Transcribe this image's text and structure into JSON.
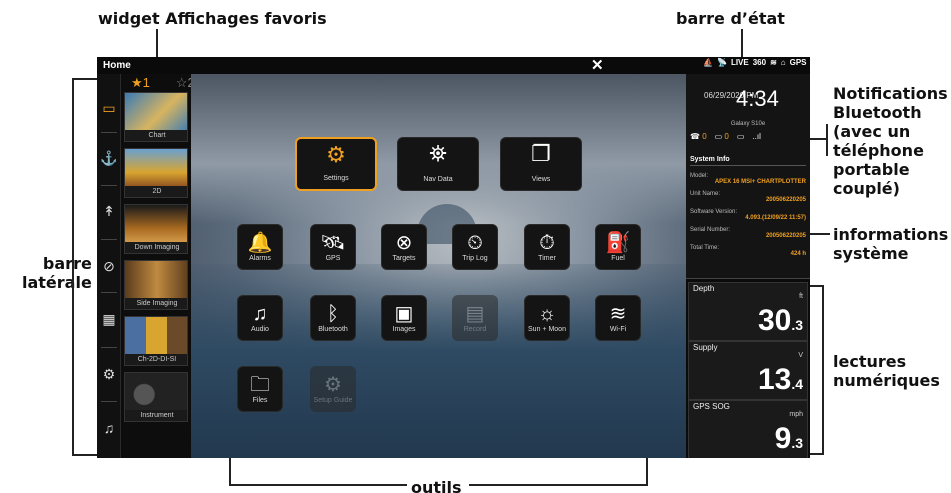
{
  "callouts": {
    "favorites_widget": "widget Affichages favoris",
    "status_bar": "barre d’état",
    "bluetooth_notifications": "Notifications\nBluetooth\n(avec un\ntéléphone\nportable\ncouplé)",
    "system_info": "informations\nsystème",
    "sidebar": "barre\nlatérale",
    "digital_readouts": "lectures\nnumériques",
    "tools": "outils"
  },
  "topbar": {
    "home": "Home",
    "close": "✕",
    "status_icons": [
      "⛵",
      "📡",
      "LIVE",
      "360",
      "≋",
      "⌂",
      "GPS"
    ]
  },
  "sidebar": {
    "items": [
      "▭",
      "⚓",
      "↟",
      "⊘",
      "▦",
      "⚙",
      "♫"
    ]
  },
  "favorites": {
    "tabs": [
      "★1",
      "☆2"
    ],
    "items": [
      {
        "label": "Chart",
        "color": "#3a7bb5"
      },
      {
        "label": "2D",
        "color": "#d8a530"
      },
      {
        "label": "Down Imaging",
        "color": "#a86a20"
      },
      {
        "label": "Side Imaging",
        "color": "#5b3b1c"
      },
      {
        "label": "Ch-2D-DI-SI",
        "color": "#4a6fa0"
      },
      {
        "label": "Instrument",
        "color": "#333333"
      }
    ]
  },
  "tools": {
    "big": [
      {
        "label": "Settings",
        "icon": "⚙"
      },
      {
        "label": "Nav Data",
        "icon": "⛯"
      },
      {
        "label": "Views",
        "icon": "❐"
      }
    ],
    "rows": [
      [
        {
          "label": "Alarms",
          "icon": "🔔"
        },
        {
          "label": "GPS",
          "icon": "🛰"
        },
        {
          "label": "Targets",
          "icon": "⊗"
        },
        {
          "label": "Trip Log",
          "icon": "⏲"
        },
        {
          "label": "Timer",
          "icon": "⏱"
        },
        {
          "label": "Fuel",
          "icon": "⛽"
        }
      ],
      [
        {
          "label": "Audio",
          "icon": "♫"
        },
        {
          "label": "Bluetooth",
          "icon": "ᛒ"
        },
        {
          "label": "Images",
          "icon": "▣"
        },
        {
          "label": "Record",
          "icon": "▤"
        },
        {
          "label": "Sun + Moon",
          "icon": "☼"
        },
        {
          "label": "Wi-Fi",
          "icon": "≋"
        }
      ],
      [
        {
          "label": "Files",
          "icon": "🗀"
        },
        {
          "label": "Setup Guide",
          "icon": "⚙"
        }
      ]
    ]
  },
  "info": {
    "date": "06/29/2020 PM",
    "time": "4:34",
    "phone": "Galaxy S10e",
    "calls": "0",
    "messages": "0",
    "battery": "▭",
    "signal": "..ıl",
    "system_info_title": "System Info",
    "model_label": "Model:",
    "model": "APEX 16 MSI+ CHARTPLOTTER",
    "unit_label": "Unit Name:",
    "unit": "200506220205",
    "sw_label": "Software Version:",
    "sw": "4.093.(12/09/22 11:57)",
    "serial_label": "Serial Number:",
    "serial": "200506220205",
    "total_label": "Total Time:",
    "total": "424 h"
  },
  "readouts": [
    {
      "name": "Depth",
      "unit": "ft",
      "whole": "30",
      "dec": ".3"
    },
    {
      "name": "Supply",
      "unit": "V",
      "whole": "13",
      "dec": ".4"
    },
    {
      "name": "GPS SOG",
      "unit": "mph",
      "whole": "9",
      "dec": ".3"
    }
  ],
  "colors": {
    "accent": "#f0a020"
  }
}
